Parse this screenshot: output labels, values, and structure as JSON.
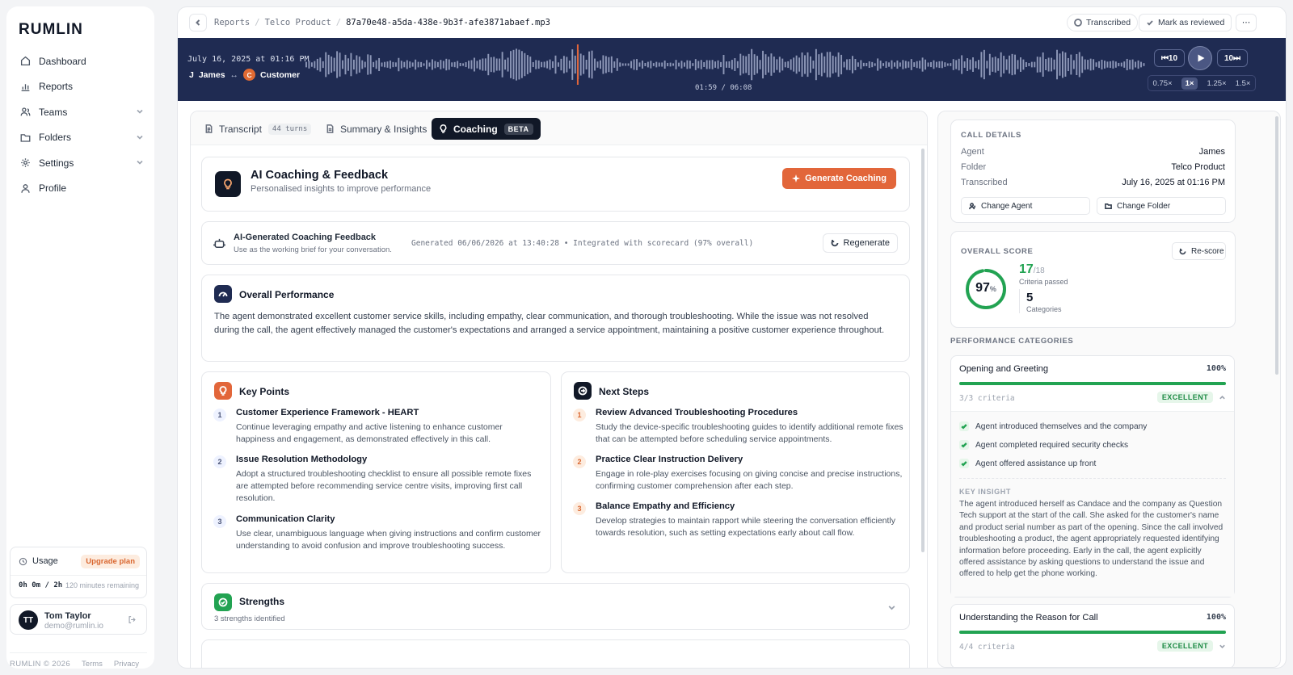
{
  "sidebar": {
    "logo": "RUMLIN",
    "nav": [
      {
        "label": "Dashboard",
        "icon": "home-icon"
      },
      {
        "label": "Reports",
        "icon": "bar-chart-icon"
      },
      {
        "label": "Teams",
        "icon": "users-icon",
        "expandable": true
      },
      {
        "label": "Folders",
        "icon": "folder-icon",
        "expandable": true
      },
      {
        "label": "Settings",
        "icon": "gear-icon",
        "expandable": true
      },
      {
        "label": "Profile",
        "icon": "user-icon"
      }
    ],
    "usage": {
      "title": "Usage",
      "upgrade": "Upgrade plan",
      "time": "0h 0m / 2h",
      "remaining": "120 minutes remaining",
      "used_fraction": 0
    },
    "user": {
      "initials": "TT",
      "name": "Tom Taylor",
      "email": "demo@rumlin.io"
    },
    "footer": {
      "copyright": "RUMLIN © 2026",
      "terms": "Terms",
      "privacy": "Privacy"
    }
  },
  "topbar": {
    "breadcrumbs": [
      "Reports",
      "Telco Product",
      "87a70e48-a5da-438e-9b3f-afe3871abaef.mp3"
    ],
    "status": "Transcribed",
    "mark_reviewed": "Mark as reviewed",
    "more": "⋯"
  },
  "player": {
    "date": "July 16, 2025 at 01:16 PM",
    "agent_initial": "J",
    "agent": "James",
    "arrow": "↔",
    "customer_initial": "C",
    "customer": "Customer",
    "time": "01:59 / 06:08",
    "progress_fraction": 0.323,
    "rewind": "⏮10",
    "forward": "10⏭",
    "speeds": [
      "0.75×",
      "1×",
      "1.25×",
      "1.5×"
    ],
    "active_speed": "1×"
  },
  "tabs": {
    "transcript": "Transcript",
    "turns": "44 turns",
    "summary": "Summary & Insights",
    "coaching": "Coaching",
    "beta": "BETA"
  },
  "coaching": {
    "header_title": "AI Coaching & Feedback",
    "header_sub": "Personalised insights to improve performance",
    "generate": "Generate Coaching",
    "feedback_title": "AI-Generated Coaching Feedback",
    "feedback_sub": "Use as the working brief for your conversation.",
    "generated": "Generated 06/06/2026 at 13:40:28 • Integrated with scorecard (97% overall)",
    "regenerate": "Regenerate",
    "overall_title": "Overall Performance",
    "overall_text": "The agent demonstrated excellent customer service skills, including empathy, clear communication, and thorough troubleshooting. While the issue was not resolved during the call, the agent effectively managed the customer's expectations and arranged a service appointment, maintaining a positive customer experience throughout.",
    "key_points_title": "Key Points",
    "key_points": [
      {
        "n": "1",
        "title": "Customer Experience Framework - HEART",
        "text": "Continue leveraging empathy and active listening to enhance customer happiness and engagement, as demonstrated effectively in this call."
      },
      {
        "n": "2",
        "title": "Issue Resolution Methodology",
        "text": "Adopt a structured troubleshooting checklist to ensure all possible remote fixes are attempted before recommending service centre visits, improving first call resolution."
      },
      {
        "n": "3",
        "title": "Communication Clarity",
        "text": "Use clear, unambiguous language when giving instructions and confirm customer understanding to avoid confusion and improve troubleshooting success."
      }
    ],
    "next_steps_title": "Next Steps",
    "next_steps": [
      {
        "n": "1",
        "title": "Review Advanced Troubleshooting Procedures",
        "text": "Study the device-specific troubleshooting guides to identify additional remote fixes that can be attempted before scheduling service appointments."
      },
      {
        "n": "2",
        "title": "Practice Clear Instruction Delivery",
        "text": "Engage in role-play exercises focusing on giving concise and precise instructions, confirming customer comprehension after each step."
      },
      {
        "n": "3",
        "title": "Balance Empathy and Efficiency",
        "text": "Develop strategies to maintain rapport while steering the conversation efficiently towards resolution, such as setting expectations early about call flow."
      }
    ],
    "strengths_title": "Strengths",
    "strengths_sub": "3 strengths identified"
  },
  "call_details": {
    "caption": "CALL DETAILS",
    "agent_label": "Agent",
    "agent": "James",
    "folder_label": "Folder",
    "folder": "Telco Product",
    "transcribed_label": "Transcribed",
    "transcribed": "July 16, 2025 at 01:16 PM",
    "change_agent": "Change Agent",
    "change_folder": "Change Folder"
  },
  "score": {
    "caption": "OVERALL SCORE",
    "rescore": "Re-score",
    "value": "97",
    "unit": "%",
    "fraction": 0.97,
    "passed": "17",
    "total": "/18",
    "passed_label": "Criteria passed",
    "categories": "5",
    "categories_label": "Categories"
  },
  "performance": {
    "caption": "PERFORMANCE CATEGORIES",
    "cat1": {
      "title": "Opening and Greeting",
      "pct": "100%",
      "fraction": 1.0,
      "criteria": "3/3 criteria",
      "badge": "EXCELLENT",
      "items": [
        "Agent introduced themselves and the company",
        "Agent completed required security checks",
        "Agent offered assistance up front"
      ],
      "insight_caption": "KEY INSIGHT",
      "insight": "The agent introduced herself as Candace and the company as Question Tech support at the start of the call. She asked for the customer's name and product serial number as part of the opening. Since the call involved troubleshooting a product, the agent appropriately requested identifying information before proceeding. Early in the call, the agent explicitly offered assistance by asking questions to understand the issue and offered to help get the phone working."
    },
    "cat2": {
      "title": "Understanding the Reason for Call",
      "pct": "100%",
      "fraction": 1.0,
      "criteria": "4/4 criteria",
      "badge": "EXCELLENT"
    }
  },
  "colors": {
    "accent": "#e2663a",
    "navy": "#1f2b52",
    "success": "#22a352"
  }
}
